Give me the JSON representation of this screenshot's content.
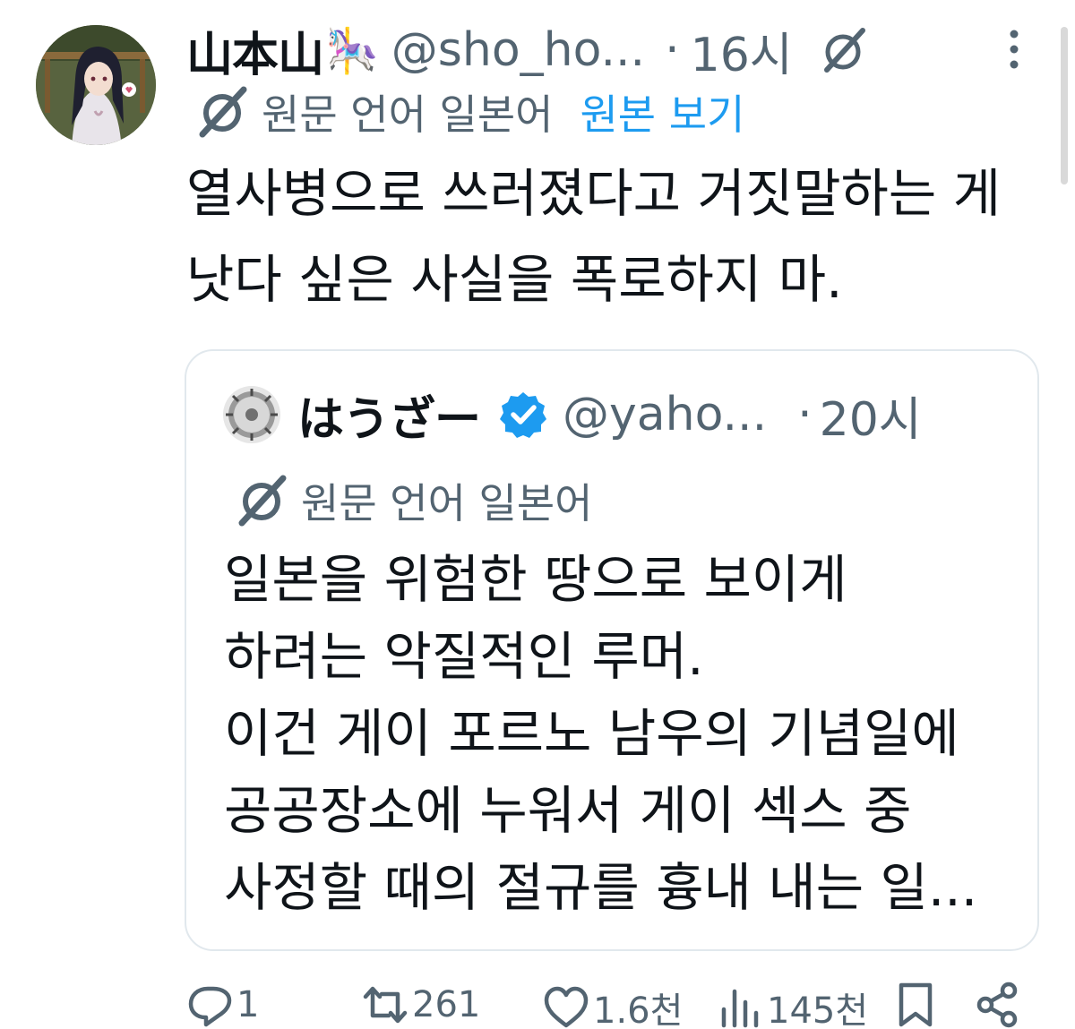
{
  "tweet": {
    "display_name": "山本山",
    "name_emoji": "🎠",
    "handle": "@sho_ho...",
    "separator": "·",
    "time": "16시",
    "translation_note": "원문 언어 일본어",
    "show_original": "원본 보기",
    "text": "열사병으로 쓰러졌다고 거짓말하는 게\n낫다 싶은 사실을 폭로하지 마."
  },
  "quote": {
    "display_name": "はうざー",
    "handle": "@yaho...",
    "separator": "·",
    "time": "20시",
    "translation_note": "원문 언어 일본어",
    "text": "일본을 위험한 땅으로 보이게\n하려는 악질적인 루머.\n이건 게이 포르노 남우의 기념일에\n공공장소에 누워서 게이 섹스 중\n사정할 때의 절규를 흉내 내는 일..."
  },
  "actions": {
    "reply_count": "1",
    "retweet_count": "261",
    "like_count": "1.6천",
    "view_count": "145천"
  },
  "icons": [
    "grok-icon",
    "more-icon",
    "translate-icon",
    "verified-badge-icon",
    "reply-icon",
    "retweet-icon",
    "like-icon",
    "views-icon",
    "bookmark-icon",
    "share-icon"
  ],
  "colors": {
    "link": "#1d9bf0",
    "secondary_text": "#536471",
    "primary_text": "#0f1419",
    "border": "#e1e8ed"
  }
}
